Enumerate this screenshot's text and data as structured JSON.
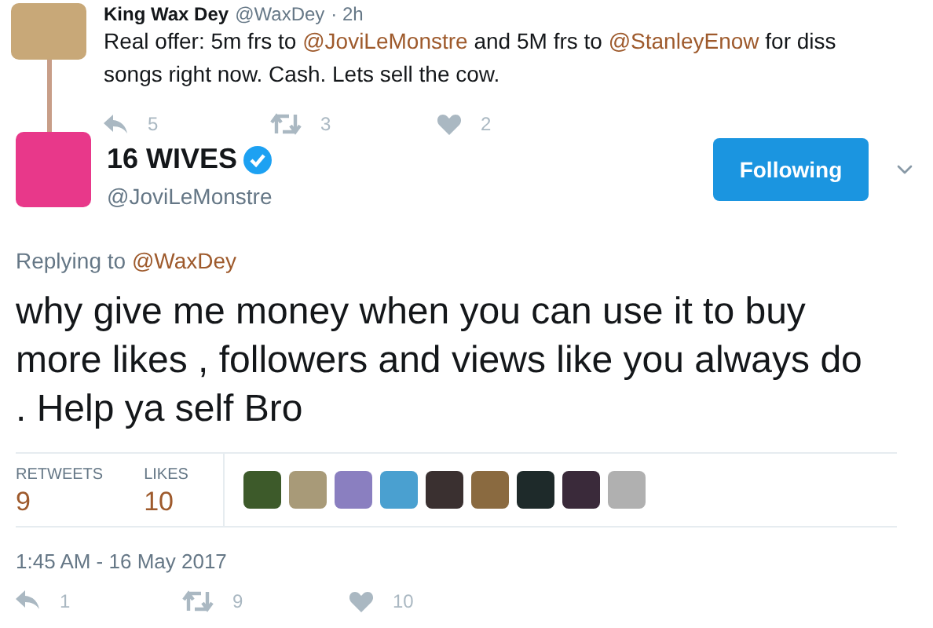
{
  "parent_tweet": {
    "name": "King Wax Dey",
    "handle": "@WaxDey",
    "time": "· 2h",
    "text_parts": [
      {
        "kind": "text",
        "text": "Real offer: 5m frs to "
      },
      {
        "kind": "mention",
        "text": "@JoviLeMonstre"
      },
      {
        "kind": "text",
        "text": " and 5M frs to "
      },
      {
        "kind": "mention",
        "text": "@StanleyEnow"
      },
      {
        "kind": "text",
        "text": " for diss songs right now. Cash. Lets sell the cow."
      }
    ],
    "actions": [
      {
        "kind": "reply",
        "count": "5"
      },
      {
        "kind": "retweet",
        "count": "3"
      },
      {
        "kind": "like",
        "count": "2"
      }
    ]
  },
  "tweet": {
    "name": "16 WIVES",
    "verified": true,
    "handle": "@JoviLeMonstre",
    "follow_button": "Following",
    "replying_label": "Replying to",
    "replying_to": "@WaxDey",
    "text": "why give me money when you can use it to buy more likes , followers and views like you always do . Help ya self Bro",
    "stats": [
      {
        "label": "RETWEETS",
        "value": "9"
      },
      {
        "label": "LIKES",
        "value": "10"
      }
    ],
    "likers": [
      {
        "color": "#3d5a2a"
      },
      {
        "color": "#a89a78"
      },
      {
        "color": "#8a7fc0"
      },
      {
        "color": "#4aa0d0"
      },
      {
        "color": "#3a3030"
      },
      {
        "color": "#8a6a40"
      },
      {
        "color": "#1e2a2a"
      },
      {
        "color": "#3a2a3a"
      },
      {
        "color": "#b0b0b0"
      }
    ],
    "timestamp": "1:45 AM - 16 May 2017",
    "actions": [
      {
        "kind": "reply",
        "count": "1"
      },
      {
        "kind": "retweet",
        "count": "9"
      },
      {
        "kind": "like",
        "count": "10"
      }
    ]
  }
}
